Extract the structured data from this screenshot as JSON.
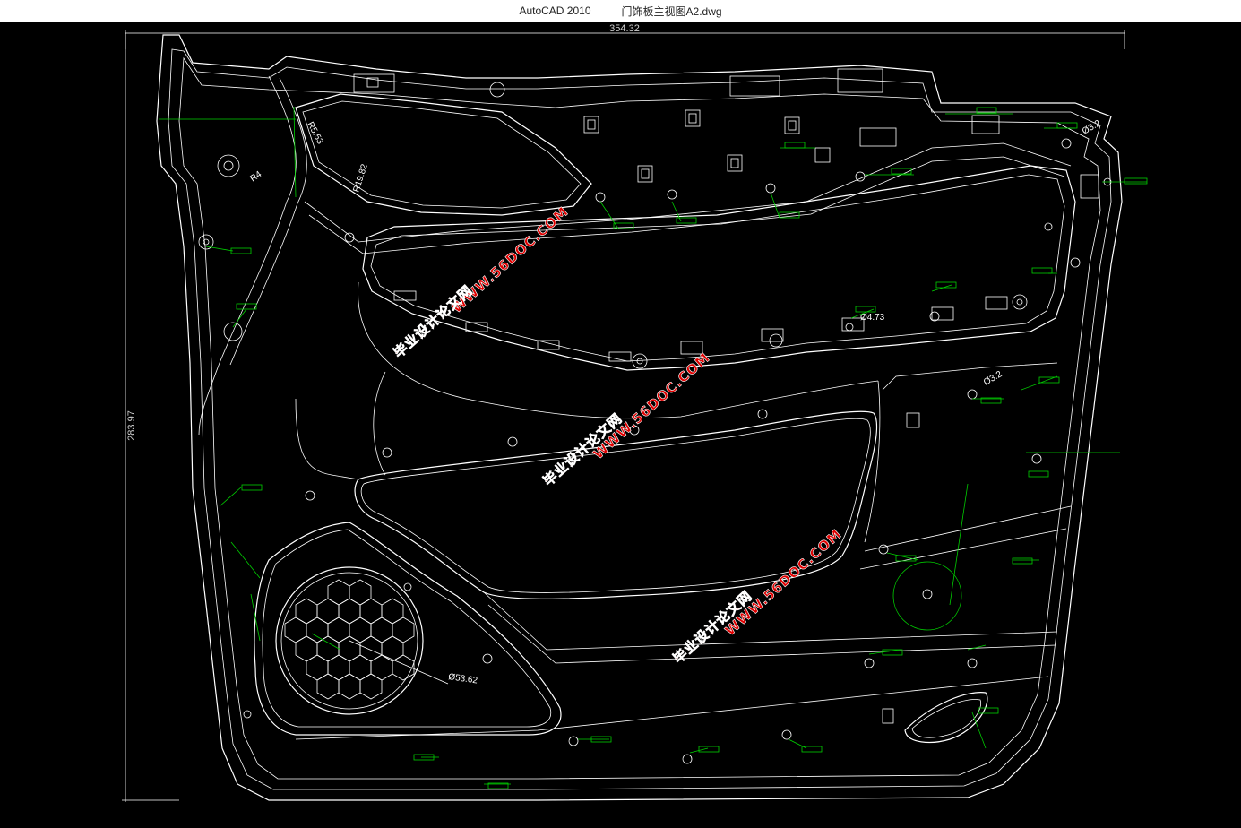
{
  "window": {
    "app_name": "AutoCAD 2010",
    "file_name": "门饰板主视图A2.dwg"
  },
  "dimensions": {
    "width": "354.32",
    "height": "283.97",
    "r_top": "R5.53",
    "r_mid": "R19.82",
    "r_left": "R4",
    "dia_speaker": "Ø53.62",
    "dia_right1": "Ø3.2",
    "dia_right2": "Ø3.2",
    "dia_mid": "Ø4.73"
  },
  "watermarks": {
    "url": "WWW.56DOC.COM",
    "site": "毕业设计论文网"
  },
  "colors": {
    "background": "#000000",
    "geometry": "#ffffff",
    "annotation": "#00d000",
    "watermark": "#e00000"
  }
}
